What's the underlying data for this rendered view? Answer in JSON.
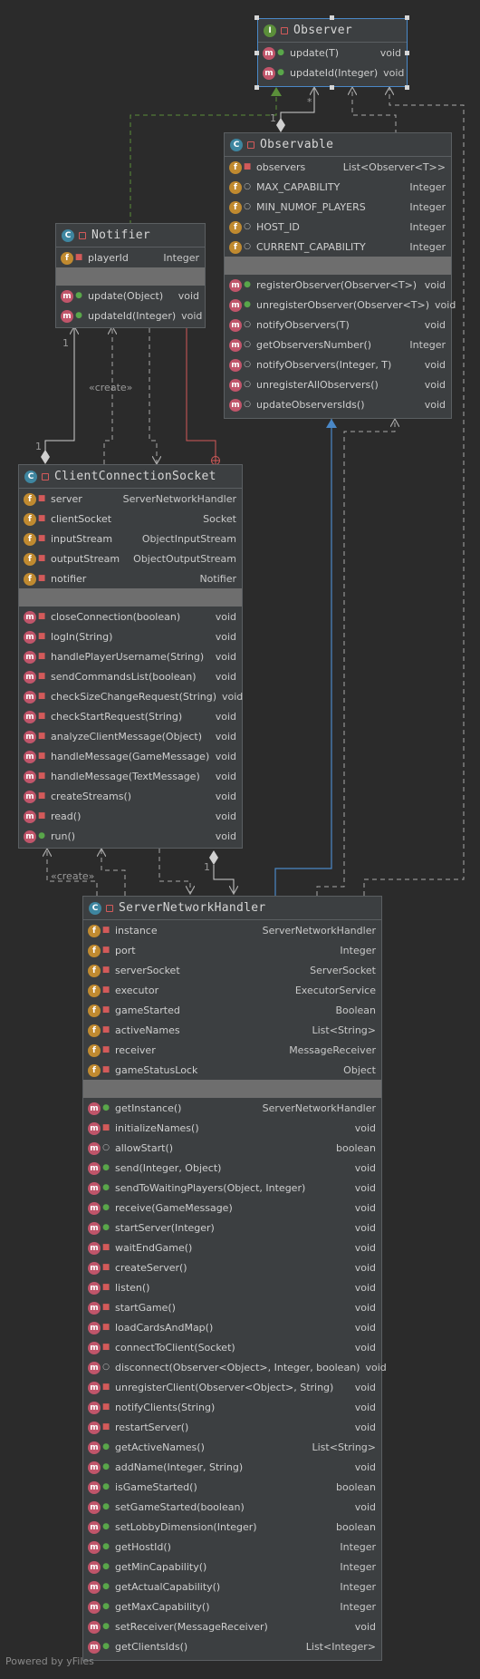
{
  "observer": {
    "name": "Observer",
    "kind": "I",
    "methods": [
      {
        "name": "update(T)",
        "type": "void",
        "vis": "pub"
      },
      {
        "name": "updateId(Integer)",
        "type": "void",
        "vis": "pub"
      }
    ]
  },
  "observable": {
    "name": "Observable",
    "kind": "C",
    "fields": [
      {
        "name": "observers",
        "type": "List<Observer<T>>",
        "vis": "pri"
      },
      {
        "name": "MAX_CAPABILITY",
        "type": "Integer",
        "vis": "pkg"
      },
      {
        "name": "MIN_NUMOF_PLAYERS",
        "type": "Integer",
        "vis": "pkg"
      },
      {
        "name": "HOST_ID",
        "type": "Integer",
        "vis": "pkg"
      },
      {
        "name": "CURRENT_CAPABILITY",
        "type": "Integer",
        "vis": "pkg"
      }
    ],
    "methods": [
      {
        "name": "registerObserver(Observer<T>)",
        "type": "void",
        "vis": "pub"
      },
      {
        "name": "unregisterObserver(Observer<T>)",
        "type": "void",
        "vis": "pub"
      },
      {
        "name": "notifyObservers(T)",
        "type": "void",
        "vis": "pkg"
      },
      {
        "name": "getObserversNumber()",
        "type": "Integer",
        "vis": "pkg"
      },
      {
        "name": "notifyObservers(Integer, T)",
        "type": "void",
        "vis": "pkg"
      },
      {
        "name": "unregisterAllObservers()",
        "type": "void",
        "vis": "pkg"
      },
      {
        "name": "updateObserversIds()",
        "type": "void",
        "vis": "pkg"
      }
    ]
  },
  "notifier": {
    "name": "Notifier",
    "kind": "C",
    "fields": [
      {
        "name": "playerId",
        "type": "Integer",
        "vis": "pri"
      }
    ],
    "methods": [
      {
        "name": "update(Object)",
        "type": "void",
        "vis": "pub"
      },
      {
        "name": "updateId(Integer)",
        "type": "void",
        "vis": "pub"
      }
    ]
  },
  "client": {
    "name": "ClientConnectionSocket",
    "kind": "C",
    "fields": [
      {
        "name": "server",
        "type": "ServerNetworkHandler",
        "vis": "pri"
      },
      {
        "name": "clientSocket",
        "type": "Socket",
        "vis": "pri"
      },
      {
        "name": "inputStream",
        "type": "ObjectInputStream",
        "vis": "pri"
      },
      {
        "name": "outputStream",
        "type": "ObjectOutputStream",
        "vis": "pri"
      },
      {
        "name": "notifier",
        "type": "Notifier",
        "vis": "pri"
      }
    ],
    "methods": [
      {
        "name": "closeConnection(boolean)",
        "type": "void",
        "vis": "pri"
      },
      {
        "name": "logIn(String)",
        "type": "void",
        "vis": "pri"
      },
      {
        "name": "handlePlayerUsername(String)",
        "type": "void",
        "vis": "pri"
      },
      {
        "name": "sendCommandsList(boolean)",
        "type": "void",
        "vis": "pri"
      },
      {
        "name": "checkSizeChangeRequest(String)",
        "type": "void",
        "vis": "pri"
      },
      {
        "name": "checkStartRequest(String)",
        "type": "void",
        "vis": "pri"
      },
      {
        "name": "analyzeClientMessage(Object)",
        "type": "void",
        "vis": "pri"
      },
      {
        "name": "handleMessage(GameMessage)",
        "type": "void",
        "vis": "pri"
      },
      {
        "name": "handleMessage(TextMessage)",
        "type": "void",
        "vis": "pri"
      },
      {
        "name": "createStreams()",
        "type": "void",
        "vis": "pri"
      },
      {
        "name": "read()",
        "type": "void",
        "vis": "pri"
      },
      {
        "name": "run()",
        "type": "void",
        "vis": "pub"
      }
    ]
  },
  "server": {
    "name": "ServerNetworkHandler",
    "kind": "C",
    "fields": [
      {
        "name": "instance",
        "type": "ServerNetworkHandler",
        "vis": "pri"
      },
      {
        "name": "port",
        "type": "Integer",
        "vis": "pri"
      },
      {
        "name": "serverSocket",
        "type": "ServerSocket",
        "vis": "pri"
      },
      {
        "name": "executor",
        "type": "ExecutorService",
        "vis": "pri"
      },
      {
        "name": "gameStarted",
        "type": "Boolean",
        "vis": "pri"
      },
      {
        "name": "activeNames",
        "type": "List<String>",
        "vis": "pri"
      },
      {
        "name": "receiver",
        "type": "MessageReceiver",
        "vis": "pri"
      },
      {
        "name": "gameStatusLock",
        "type": "Object",
        "vis": "pri"
      }
    ],
    "methods": [
      {
        "name": "getInstance()",
        "type": "ServerNetworkHandler",
        "vis": "pub"
      },
      {
        "name": "initializeNames()",
        "type": "void",
        "vis": "pri"
      },
      {
        "name": "allowStart()",
        "type": "boolean",
        "vis": "pkg"
      },
      {
        "name": "send(Integer, Object)",
        "type": "void",
        "vis": "pub"
      },
      {
        "name": "sendToWaitingPlayers(Object, Integer)",
        "type": "void",
        "vis": "pub"
      },
      {
        "name": "receive(GameMessage)",
        "type": "void",
        "vis": "pub"
      },
      {
        "name": "startServer(Integer)",
        "type": "void",
        "vis": "pub"
      },
      {
        "name": "waitEndGame()",
        "type": "void",
        "vis": "pri"
      },
      {
        "name": "createServer()",
        "type": "void",
        "vis": "pri"
      },
      {
        "name": "listen()",
        "type": "void",
        "vis": "pri"
      },
      {
        "name": "startGame()",
        "type": "void",
        "vis": "pri"
      },
      {
        "name": "loadCardsAndMap()",
        "type": "void",
        "vis": "pri"
      },
      {
        "name": "connectToClient(Socket)",
        "type": "void",
        "vis": "pri"
      },
      {
        "name": "disconnect(Observer<Object>, Integer, boolean)",
        "type": "void",
        "vis": "pkg"
      },
      {
        "name": "unregisterClient(Observer<Object>, String)",
        "type": "void",
        "vis": "pri"
      },
      {
        "name": "notifyClients(String)",
        "type": "void",
        "vis": "pri"
      },
      {
        "name": "restartServer()",
        "type": "void",
        "vis": "pri"
      },
      {
        "name": "getActiveNames()",
        "type": "List<String>",
        "vis": "pub"
      },
      {
        "name": "addName(Integer, String)",
        "type": "void",
        "vis": "pub"
      },
      {
        "name": "isGameStarted()",
        "type": "boolean",
        "vis": "pub"
      },
      {
        "name": "setGameStarted(boolean)",
        "type": "void",
        "vis": "pub"
      },
      {
        "name": "setLobbyDimension(Integer)",
        "type": "boolean",
        "vis": "pub"
      },
      {
        "name": "getHostId()",
        "type": "Integer",
        "vis": "pub"
      },
      {
        "name": "getMinCapability()",
        "type": "Integer",
        "vis": "pub"
      },
      {
        "name": "getActualCapability()",
        "type": "Integer",
        "vis": "pub"
      },
      {
        "name": "getMaxCapability()",
        "type": "Integer",
        "vis": "pub"
      },
      {
        "name": "setReceiver(MessageReceiver)",
        "type": "void",
        "vis": "pub"
      },
      {
        "name": "getClientsIds()",
        "type": "List<Integer>",
        "vis": "pub"
      }
    ]
  },
  "edge_labels": {
    "create_1": "«create»",
    "create_2": "«create»",
    "mult_notifier_top": "1",
    "mult_notifier_bottom": "1",
    "mult_observable": "1",
    "mult_observer_star": "*",
    "mult_server_1": "1"
  },
  "footer": "Powered by yFiles",
  "colors": {
    "background": "#2b2b2b",
    "node": "#3c3f41",
    "selected": "#4a88c7",
    "realization": "#5b8f3a",
    "generalization": "#4a88c7",
    "inner": "#d35a5a",
    "dashed": "#a9a9a9"
  }
}
